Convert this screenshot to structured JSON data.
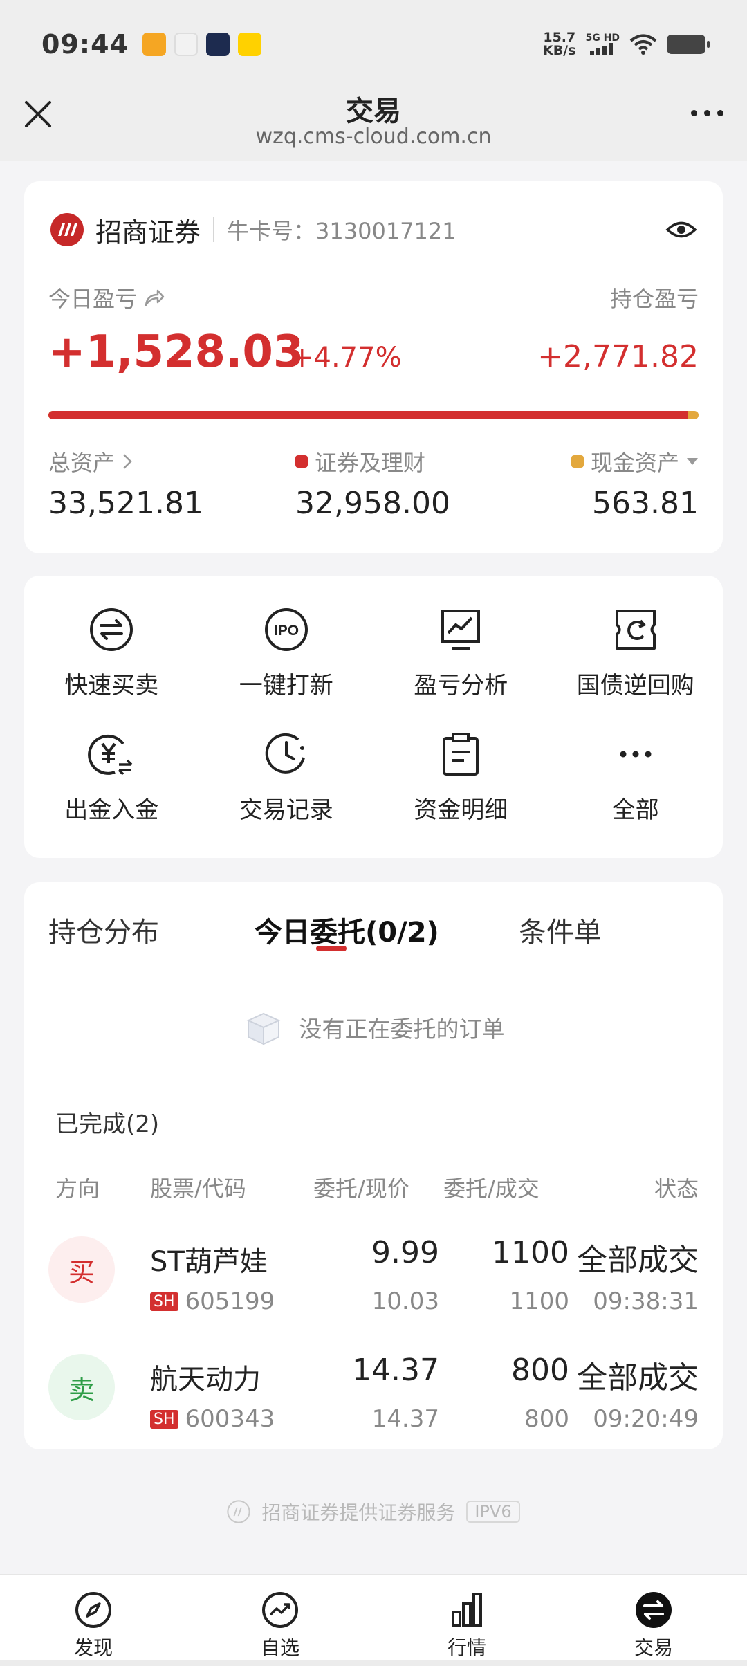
{
  "status_bar": {
    "time": "09:44",
    "net_speed_value": "15.7",
    "net_speed_unit": "KB/s",
    "network": "5G HD"
  },
  "titlebar": {
    "title": "交易",
    "url": "wzq.cms-cloud.com.cn"
  },
  "account": {
    "broker_name": "招商证券",
    "card_no": "牛卡号：3130017121",
    "today_pl_label": "今日盈亏",
    "today_pl_value": "+1,528.03",
    "today_pl_pct": "+4.77%",
    "hold_pl_label": "持仓盈亏",
    "hold_pl_value": "+2,771.82",
    "securities_share": 0.983,
    "total_assets_label": "总资产",
    "total_assets_value": "33,521.81",
    "securities_label": "证券及理财",
    "securities_value": "32,958.00",
    "cash_label": "现金资产",
    "cash_value": "563.81"
  },
  "functions": [
    {
      "label": "快速买卖",
      "icon": "swap-icon"
    },
    {
      "label": "一键打新",
      "icon": "ipo-icon"
    },
    {
      "label": "盈亏分析",
      "icon": "chart-monitor-icon"
    },
    {
      "label": "国债逆回购",
      "icon": "repo-icon"
    },
    {
      "label": "出金入金",
      "icon": "yuan-transfer-icon"
    },
    {
      "label": "交易记录",
      "icon": "clock-icon"
    },
    {
      "label": "资金明细",
      "icon": "clipboard-icon"
    },
    {
      "label": "全部",
      "icon": "more-dots-icon"
    }
  ],
  "orders": {
    "tabs": [
      "持仓分布",
      "今日委托(0/2)",
      "条件单"
    ],
    "active_tab": 1,
    "empty_text": "没有正在委托的订单",
    "completed_title": "已完成(2)",
    "headers": [
      "方向",
      "股票/代码",
      "委托/现价",
      "委托/成交",
      "状态"
    ],
    "rows": [
      {
        "direction": "买",
        "side": "buy",
        "name": "ST葫芦娃",
        "market": "SH",
        "code": "605199",
        "order_price": "9.99",
        "current_price": "10.03",
        "order_qty": "1100",
        "filled_qty": "1100",
        "status": "全部成交",
        "time": "09:38:31"
      },
      {
        "direction": "卖",
        "side": "sell",
        "name": "航天动力",
        "market": "SH",
        "code": "600343",
        "order_price": "14.37",
        "current_price": "14.37",
        "order_qty": "800",
        "filled_qty": "800",
        "status": "全部成交",
        "time": "09:20:49"
      }
    ]
  },
  "footer": {
    "note": "招商证券提供证券服务",
    "ipv6": "IPV6"
  },
  "bottom_nav": [
    {
      "label": "发现",
      "icon": "compass-icon"
    },
    {
      "label": "自选",
      "icon": "trend-icon"
    },
    {
      "label": "行情",
      "icon": "bar-chart-icon"
    },
    {
      "label": "交易",
      "icon": "trade-icon"
    }
  ],
  "colors": {
    "up_red": "#d32f2f",
    "down_green": "#2e9d47",
    "cash_gold": "#e3a83d",
    "background": "#f4f4f6"
  }
}
